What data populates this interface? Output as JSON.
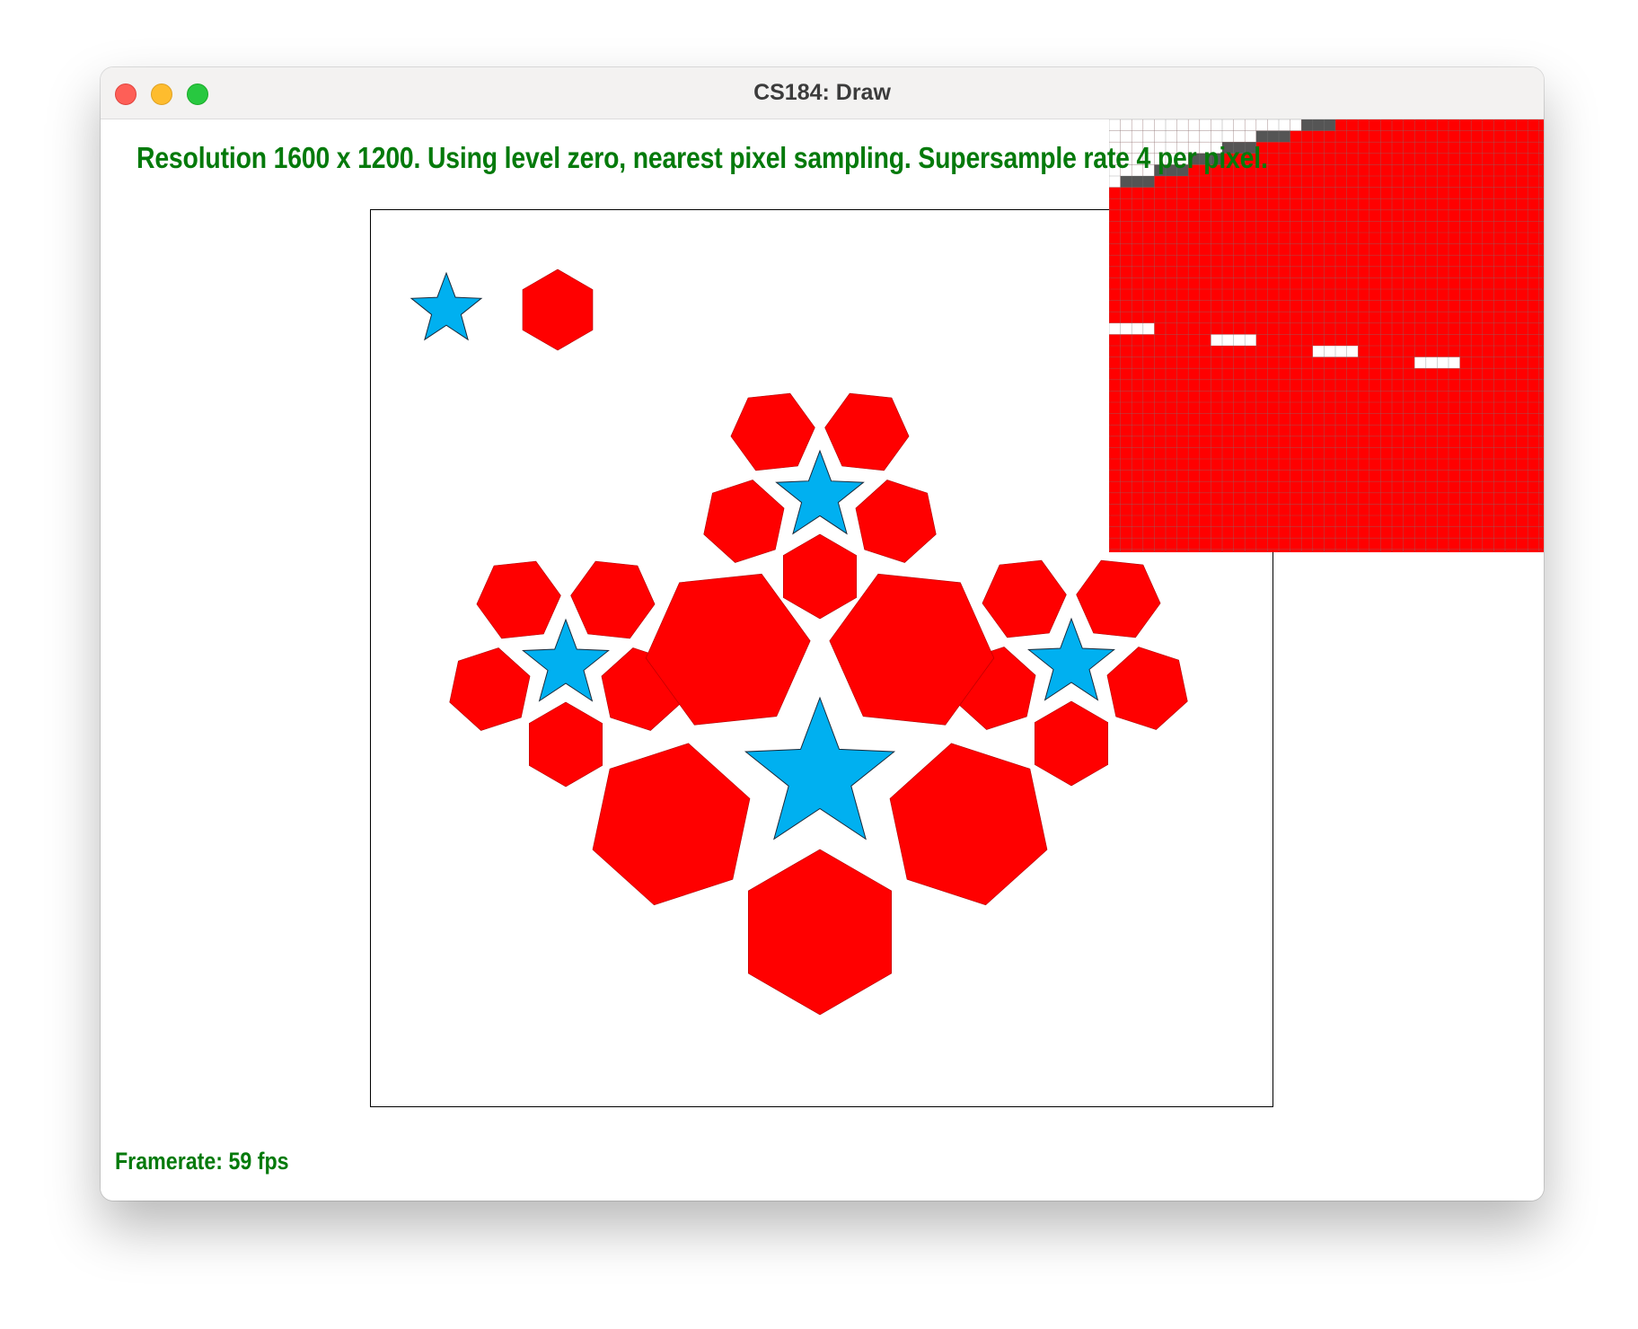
{
  "window": {
    "title": "CS184: Draw"
  },
  "overlay": {
    "status_text": "Resolution 1600 x 1200. Using level zero, nearest pixel sampling. Supersample rate 4 per pixel.",
    "framerate_text": "Framerate: 59 fps"
  },
  "colors": {
    "hexagon_fill": "#ff0000",
    "star_fill": "#00b0f0",
    "status_text": "#047a0b",
    "zoom_gray": "#555555"
  },
  "icons": {
    "close": "close-icon",
    "minimize": "minimize-icon",
    "maximize": "maximize-icon"
  }
}
